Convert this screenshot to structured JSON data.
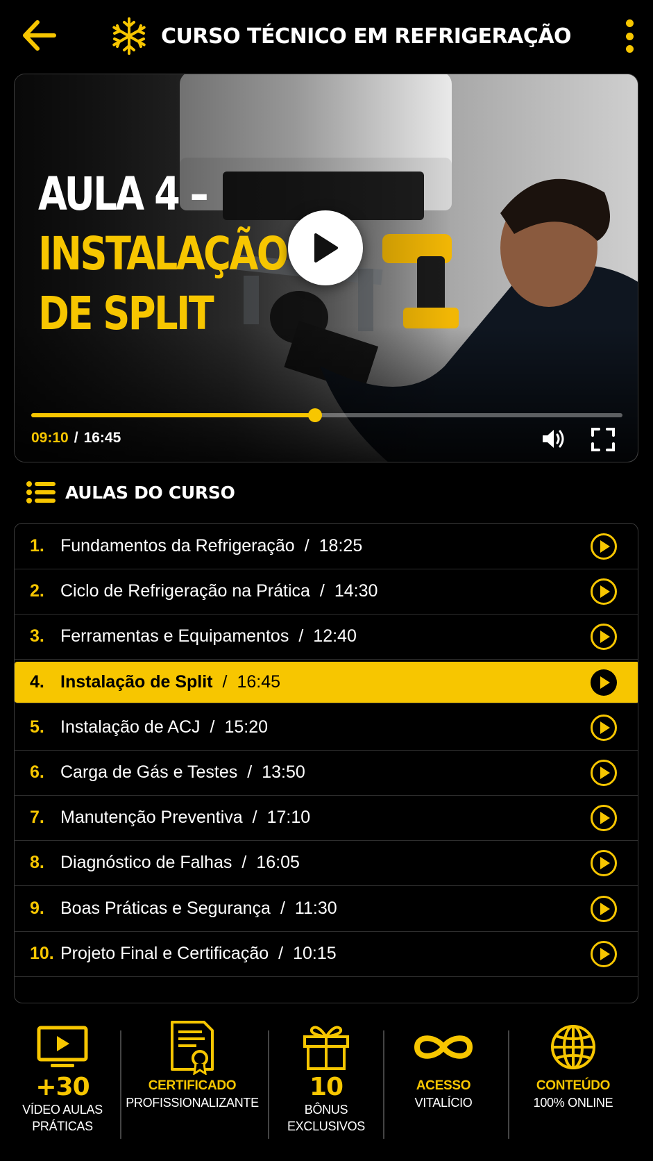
{
  "header": {
    "title": "CURSO TÉCNICO EM REFRIGERAÇÃO",
    "back_icon": "arrow-left-icon",
    "logo_icon": "snowflake-icon",
    "menu_icon": "more-vertical-icon"
  },
  "player": {
    "title_line1": "AULA 4 –",
    "title_line2": "INSTALAÇÃO",
    "title_line3": "DE SPLIT",
    "current_time": "09:10",
    "separator": "/",
    "duration": "16:45",
    "progress": 0.48,
    "play_icon": "play-icon",
    "volume_icon": "volume-icon",
    "fullscreen_icon": "fullscreen-icon"
  },
  "lessons_section": {
    "title": "AULAS DO CURSO",
    "icon": "list-icon",
    "items": [
      {
        "num": "1.",
        "name": "Fundamentos da Refrigeração",
        "duration": "18:25",
        "active": false
      },
      {
        "num": "2.",
        "name": "Ciclo de Refrigeração na Prática",
        "duration": "14:30",
        "active": false
      },
      {
        "num": "3.",
        "name": "Ferramentas e Equipamentos",
        "duration": "12:40",
        "active": false
      },
      {
        "num": "4.",
        "name": "Instalação de Split",
        "duration": "16:45",
        "active": true
      },
      {
        "num": "5.",
        "name": "Instalação de ACJ",
        "duration": "15:20",
        "active": false
      },
      {
        "num": "6.",
        "name": "Carga de Gás e Testes",
        "duration": "13:50",
        "active": false
      },
      {
        "num": "7.",
        "name": "Manutenção Preventiva",
        "duration": "17:10",
        "active": false
      },
      {
        "num": "8.",
        "name": "Diagnóstico de Falhas",
        "duration": "16:05",
        "active": false
      },
      {
        "num": "9.",
        "name": "Boas Práticas e Segurança",
        "duration": "11:30",
        "active": false
      },
      {
        "num": "10.",
        "name": "Projeto Final e Certificação",
        "duration": "10:15",
        "active": false
      }
    ]
  },
  "features": {
    "videos": {
      "big": "+30",
      "line1": "VÍDEO AULAS",
      "line2": "PRÁTICAS",
      "icon": "video-screen-icon"
    },
    "certificate": {
      "line1": "CERTIFICADO",
      "line2": "PROFISSIONALIZANTE",
      "icon": "certificate-icon"
    },
    "bonus": {
      "big": "10",
      "line1": "BÔNUS",
      "line2": "EXCLUSIVOS",
      "icon": "gift-icon"
    },
    "access": {
      "line1": "ACESSO",
      "line2": "VITALÍCIO",
      "icon": "infinity-icon"
    },
    "online": {
      "line1": "CONTEÚDO",
      "line2": "100% ONLINE",
      "icon": "globe-icon"
    }
  },
  "colors": {
    "accent": "#f7c600",
    "background": "#000000",
    "text": "#ffffff"
  }
}
